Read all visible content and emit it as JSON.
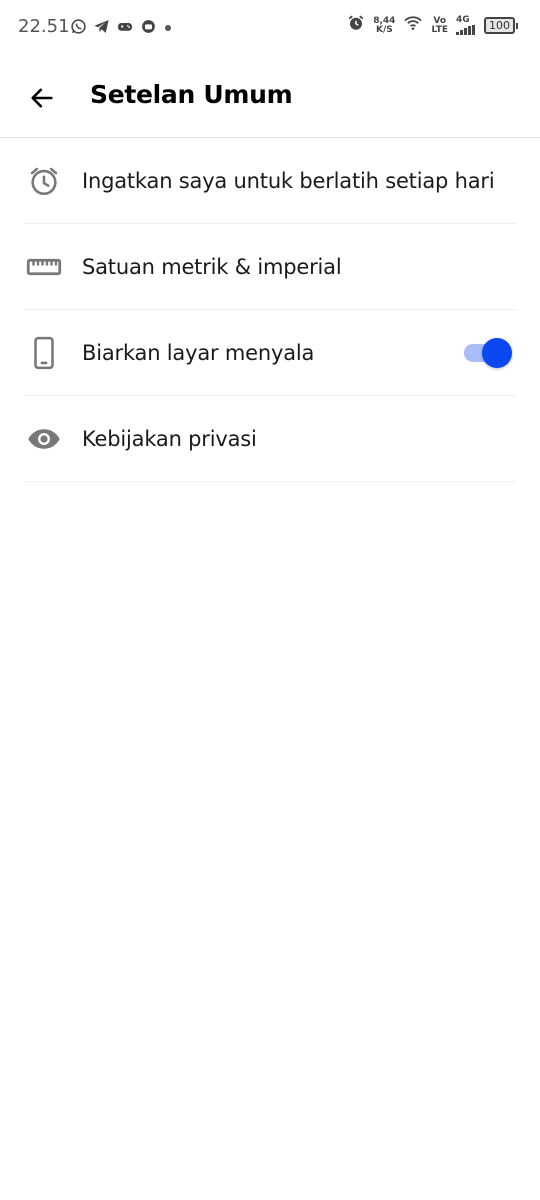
{
  "status_bar": {
    "time": "22.51",
    "net_speed_value": "8,44",
    "net_speed_unit": "K/S",
    "volte_top": "Vo",
    "volte_bottom": "LTE",
    "network": "4G",
    "battery": "100",
    "left_icons": [
      "whatsapp-icon",
      "telegram-icon",
      "game-controller-icon",
      "app-icon",
      "dot-icon"
    ],
    "right_icons": [
      "alarm-icon",
      "wifi-icon",
      "signal-icon",
      "battery-icon"
    ]
  },
  "header": {
    "title": "Setelan Umum",
    "back_icon": "arrow-left-icon"
  },
  "settings": {
    "items": [
      {
        "label": "Ingatkan saya untuk berlatih setiap hari",
        "icon": "alarm-clock-icon"
      },
      {
        "label": "Satuan metrik & imperial",
        "icon": "ruler-icon"
      },
      {
        "label": "Biarkan layar menyala",
        "icon": "phone-icon",
        "toggle_on": true
      },
      {
        "label": "Kebijakan privasi",
        "icon": "eye-icon"
      }
    ]
  },
  "colors": {
    "accent": "#0b48f2",
    "toggle_track": "#a9bdf6",
    "icon_gray": "#777777",
    "divider": "#efefef"
  }
}
